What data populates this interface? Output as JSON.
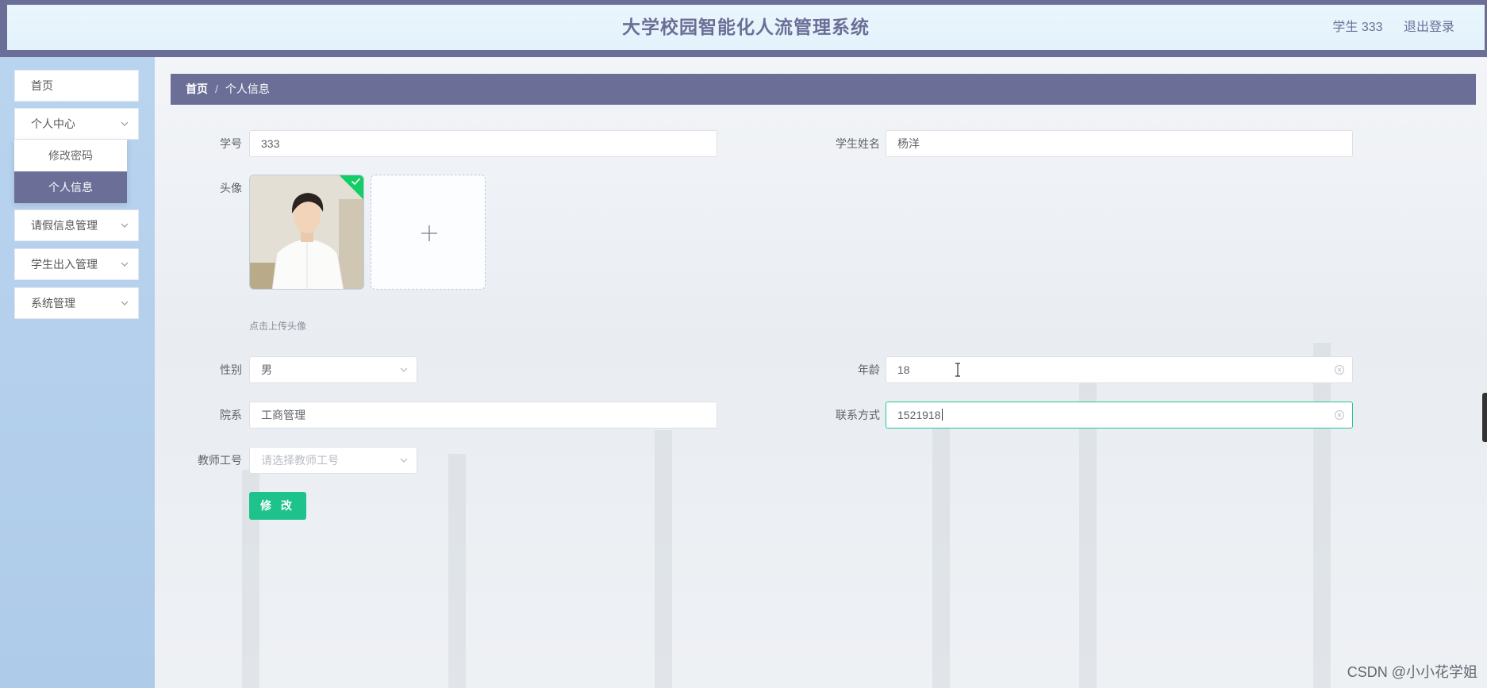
{
  "header": {
    "title": "大学校园智能化人流管理系统",
    "user_label": "学生 333",
    "logout_label": "退出登录"
  },
  "sidebar": {
    "items": [
      {
        "label": "首页",
        "has_children": false
      },
      {
        "label": "个人中心",
        "has_children": true,
        "expanded": true
      },
      {
        "label": "请假信息管理",
        "has_children": true
      },
      {
        "label": "学生出入管理",
        "has_children": true
      },
      {
        "label": "系统管理",
        "has_children": true
      }
    ],
    "submenu": [
      {
        "label": "修改密码",
        "active": false
      },
      {
        "label": "个人信息",
        "active": true
      }
    ]
  },
  "breadcrumb": {
    "home": "首页",
    "separator": "/",
    "current": "个人信息"
  },
  "form": {
    "student_id": {
      "label": "学号",
      "value": "333"
    },
    "student_name": {
      "label": "学生姓名",
      "value": "杨洋"
    },
    "avatar": {
      "label": "头像",
      "hint": "点击上传头像",
      "upload_icon": "plus-icon"
    },
    "gender": {
      "label": "性别",
      "value": "男"
    },
    "age": {
      "label": "年龄",
      "value": "18"
    },
    "department": {
      "label": "院系",
      "value": "工商管理"
    },
    "contact": {
      "label": "联系方式",
      "value": "1521918"
    },
    "teacher_id": {
      "label": "教师工号",
      "placeholder": "请选择教师工号"
    },
    "submit_label": "修 改"
  },
  "watermark": "CSDN @小小花学姐",
  "colors": {
    "primary": "#6b6f97",
    "accent_green": "#1ec28b",
    "focus_border": "#27c493",
    "upload_success": "#13ce66"
  }
}
